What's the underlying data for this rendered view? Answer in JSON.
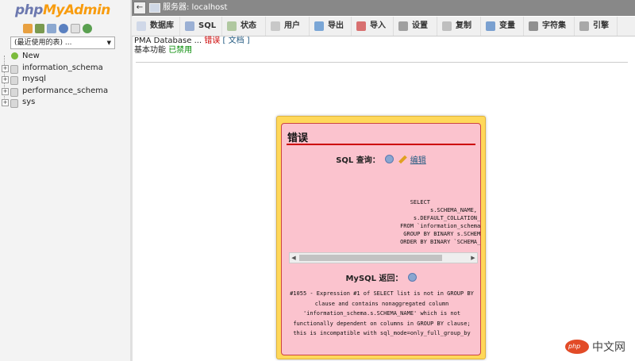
{
  "app": {
    "logo_php": "php",
    "logo_my": "My",
    "logo_admin": "Admin"
  },
  "sidebar": {
    "recent_select": "(最近使用的表) ...",
    "quick_icons": [
      "home-icon",
      "database-icon",
      "sql-icon",
      "help-icon",
      "docs-icon",
      "refresh-icon"
    ],
    "tree": [
      {
        "label": "New",
        "type": "new"
      },
      {
        "label": "information_schema",
        "type": "db"
      },
      {
        "label": "mysql",
        "type": "db"
      },
      {
        "label": "performance_schema",
        "type": "db"
      },
      {
        "label": "sys",
        "type": "db"
      }
    ]
  },
  "topbar": {
    "back": "←",
    "server_label": "服务器: localhost"
  },
  "tabs": [
    {
      "label": "数据库",
      "icon": "database-icon",
      "color": "#d0d8e8"
    },
    {
      "label": "SQL",
      "icon": "sql-icon",
      "color": "#9bb0d4"
    },
    {
      "label": "状态",
      "icon": "status-icon",
      "color": "#b0c8a0"
    },
    {
      "label": "用户",
      "icon": "users-icon",
      "color": "#c8c8c8"
    },
    {
      "label": "导出",
      "icon": "export-icon",
      "color": "#7aa6d6"
    },
    {
      "label": "导入",
      "icon": "import-icon",
      "color": "#d87070"
    },
    {
      "label": "设置",
      "icon": "settings-icon",
      "color": "#a0a0a0"
    },
    {
      "label": "复制",
      "icon": "replication-icon",
      "color": "#bfbfbf"
    },
    {
      "label": "变量",
      "icon": "variables-icon",
      "color": "#7aa0d0"
    },
    {
      "label": "字符集",
      "icon": "charset-icon",
      "color": "#909090"
    },
    {
      "label": "引擎",
      "icon": "engine-icon",
      "color": "#a8a8a8"
    }
  ],
  "crumb": {
    "prefix": "PMA Database ... ",
    "error": "错误",
    "docs": "[ 文档 ]"
  },
  "features": {
    "label": "基本功能 ",
    "status": "已禁用"
  },
  "modal": {
    "title": "错误",
    "sql_query_label": "SQL 查询：",
    "edit_label": "编辑",
    "sql_code": "                                    SELECT\n                                          s.SCHEMA_NAME,\n                                     s.DEFAULT_COLLATION_NAME\n                                 FROM `information_schema`.SCHEMATA\n                                  GROUP BY BINARY s.SCHEMA_NAME\n                                 ORDER BY BINARY `SCHEMA_NAME` ASC",
    "mysql_return_label": "MySQL 返回：",
    "error_message": "#1055 - Expression #1 of SELECT list is not in GROUP BY clause and contains nonaggregated column 'information_schema.s.SCHEMA_NAME' which is not functionally dependent on columns in GROUP BY clause; this is incompatible with sql_mode=only_full_group_by"
  },
  "watermark": {
    "logo": "php",
    "text": "中文网"
  }
}
